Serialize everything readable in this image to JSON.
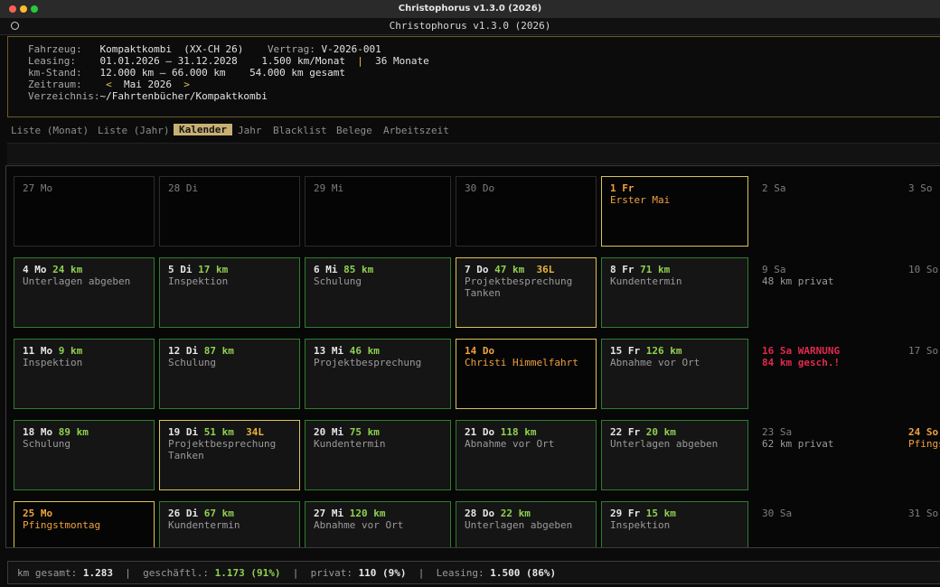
{
  "window": {
    "mac_title": "Christophorus v1.3.0 (2026)",
    "term_title": "Christophorus v1.3.0 (2026)"
  },
  "header": {
    "fahrzeug_label": "Fahrzeug:",
    "fahrzeug_value": "Kompaktkombi  (XX-CH 26)",
    "vertrag_label": "Vertrag:",
    "vertrag_value": "V-2026-001",
    "leasing_label": "Leasing:",
    "leasing_period": "01.01.2026 — 31.12.2028",
    "leasing_km": "1.500 km/Monat",
    "leasing_sep": "|",
    "leasing_months": "36 Monate",
    "kmstand_label": "km-Stand:",
    "kmstand_range": "12.000 km — 66.000 km",
    "kmstand_total": "54.000 km gesamt",
    "zeitraum_label": "Zeitraum:",
    "zeitraum_prev": "<",
    "zeitraum_value": "Mai 2026",
    "zeitraum_next": ">",
    "verzeichnis_label": "Verzeichnis:",
    "verzeichnis_value": "~/Fahrtenbücher/Kompaktkombi"
  },
  "tabs": [
    {
      "label": "Liste (Monat)",
      "active": false
    },
    {
      "label": "Liste (Jahr)",
      "active": false
    },
    {
      "label": "Kalender",
      "active": true
    },
    {
      "label": "Jahr",
      "active": false
    },
    {
      "label": "Blacklist",
      "active": false
    },
    {
      "label": "Belege",
      "active": false
    },
    {
      "label": "Arbeitszeit",
      "active": false
    }
  ],
  "calendar": {
    "rows": [
      [
        {
          "day": "27 Mo",
          "style": "plain"
        },
        {
          "day": "28 Di",
          "style": "plain"
        },
        {
          "day": "29 Mi",
          "style": "plain"
        },
        {
          "day": "30 Do",
          "style": "plain"
        },
        {
          "day": "1 Fr",
          "style": "holiday",
          "sub": "Erster Mai"
        },
        {
          "day": "2 Sa",
          "style": "none"
        },
        {
          "day": "3 So",
          "style": "none"
        }
      ],
      [
        {
          "day": "4 Mo",
          "km": "24 km",
          "sub": "Unterlagen abgeben",
          "style": "green"
        },
        {
          "day": "5 Di",
          "km": "17 km",
          "sub": "Inspektion",
          "style": "green"
        },
        {
          "day": "6 Mi",
          "km": "85 km",
          "sub": "Schulung",
          "style": "green"
        },
        {
          "day": "7 Do",
          "km": "47 km",
          "fuel": "36L",
          "sub": "Projektbesprechung",
          "sub2": "Tanken",
          "style": "gold"
        },
        {
          "day": "8 Fr",
          "km": "71 km",
          "sub": "Kundentermin",
          "style": "green"
        },
        {
          "day": "9 Sa",
          "sub": "48 km privat",
          "style": "none"
        },
        {
          "day": "10 So",
          "style": "none"
        }
      ],
      [
        {
          "day": "11 Mo",
          "km": "9 km",
          "sub": "Inspektion",
          "style": "green"
        },
        {
          "day": "12 Di",
          "km": "87 km",
          "sub": "Schulung",
          "style": "green"
        },
        {
          "day": "13 Mi",
          "km": "46 km",
          "sub": "Projektbesprechung",
          "style": "green"
        },
        {
          "day": "14 Do",
          "sub": "Christi Himmelfahrt",
          "style": "holiday"
        },
        {
          "day": "15 Fr",
          "km": "126 km",
          "sub": "Abnahme vor Ort",
          "style": "green"
        },
        {
          "day": "16 Sa WARNUNG",
          "sub": "84 km gesch.!",
          "style": "warn"
        },
        {
          "day": "17 So",
          "style": "none"
        }
      ],
      [
        {
          "day": "18 Mo",
          "km": "89 km",
          "sub": "Schulung",
          "style": "green"
        },
        {
          "day": "19 Di",
          "km": "51 km",
          "fuel": "34L",
          "sub": "Projektbesprechung",
          "sub2": "Tanken",
          "style": "gold"
        },
        {
          "day": "20 Mi",
          "km": "75 km",
          "sub": "Kundentermin",
          "style": "green"
        },
        {
          "day": "21 Do",
          "km": "118 km",
          "sub": "Abnahme vor Ort",
          "style": "green"
        },
        {
          "day": "22 Fr",
          "km": "20 km",
          "sub": "Unterlagen abgeben",
          "style": "green"
        },
        {
          "day": "23 Sa",
          "sub": "62 km privat",
          "style": "none"
        },
        {
          "day": "24 So",
          "sub": "Pfingstsonntag",
          "style": "none-holiday"
        }
      ],
      [
        {
          "day": "25 Mo",
          "sub": "Pfingstmontag",
          "style": "holiday"
        },
        {
          "day": "26 Di",
          "km": "67 km",
          "sub": "Kundentermin",
          "style": "green"
        },
        {
          "day": "27 Mi",
          "km": "120 km",
          "sub": "Abnahme vor Ort",
          "style": "green"
        },
        {
          "day": "28 Do",
          "km": "22 km",
          "sub": "Unterlagen abgeben",
          "style": "green"
        },
        {
          "day": "29 Fr",
          "km": "15 km",
          "sub": "Inspektion",
          "style": "green"
        },
        {
          "day": "30 Sa",
          "style": "none"
        },
        {
          "day": "31 So",
          "style": "none"
        }
      ]
    ]
  },
  "footer": {
    "km_gesamt_label": "km gesamt:",
    "km_gesamt_value": "1.283",
    "geschaeftl_label": "geschäftl.:",
    "geschaeftl_value": "1.173 (91%)",
    "privat_label": "privat:",
    "privat_value": "110 (9%)",
    "leasing_label": "Leasing:",
    "leasing_value": "1.500 (86%)",
    "sep": "|"
  }
}
